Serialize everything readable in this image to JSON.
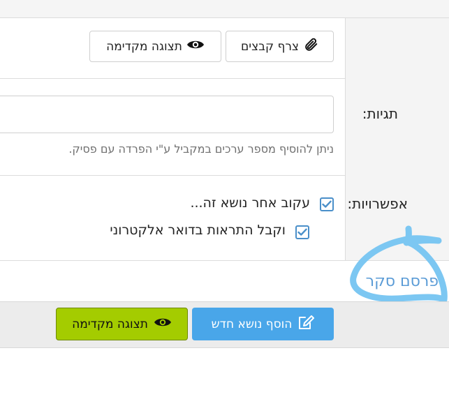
{
  "toolbar": {
    "attach_label": "צרף קבצים",
    "preview_label": "תצוגה מקדימה"
  },
  "tags": {
    "label": "תגיות:",
    "input_value": "",
    "help": "ניתן להוסיף מספר ערכים במקביל ע\"י הפרדה עם פסיק."
  },
  "options": {
    "label": "אפשרויות:",
    "follow_label": "עקוב אחר נושא זה...",
    "follow_checked": true,
    "email_label": "וקבל התראות בדואר אלקטרוני",
    "email_checked": true
  },
  "publish": {
    "label": "פרסם סקר"
  },
  "footer": {
    "add_topic_label": "הוסף נושא חדש",
    "preview_label": "תצוגה מקדימה"
  },
  "colors": {
    "primary": "#49a6e9",
    "success": "#a4cc00",
    "highlight_scribble": "#7cc7f2"
  }
}
